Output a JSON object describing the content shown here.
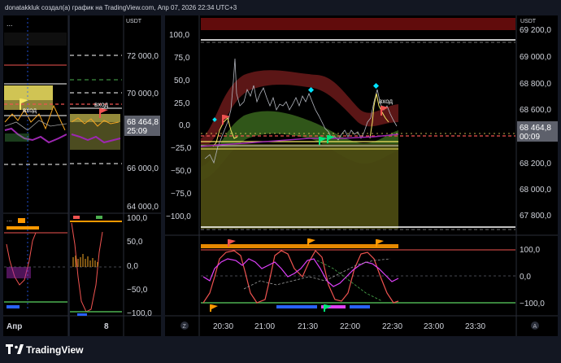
{
  "header": {
    "caption": "donatakkluk создал(а) график на TradingView.com, Апр 07, 2026 22:34 UTC+3"
  },
  "panes": {
    "left1": {
      "currency": "USDT",
      "dots": "...",
      "entry_label": "вход",
      "x_label": "Апр",
      "indicator_dots": "..."
    },
    "left2": {
      "currency": "USDT",
      "entry_label": "вход",
      "price_ticks": [
        "72 000,0",
        "70 000,0",
        "66 000,0",
        "64 000,0"
      ],
      "price_badge_value": "68 464,8",
      "price_badge_time": "25:09",
      "osc_ticks": [
        "100,0",
        "50,0",
        "0,0",
        "−50,0",
        "−100,0"
      ],
      "x_label": "8"
    },
    "main": {
      "currency": "USDT",
      "entry_label": "вход",
      "left_ticks": [
        "100,0",
        "75,0",
        "50,0",
        "25,0",
        "0,0",
        "−25,0",
        "−50,0",
        "−75,0",
        "−100,0"
      ],
      "right_ticks": [
        "69 200,0",
        "69 000,0",
        "68 800,0",
        "68 600,0",
        "68 200,0",
        "68 000,0",
        "67 800,0"
      ],
      "price_badge_value": "68 464,8",
      "price_badge_time": "00:09",
      "osc_ticks": [
        "100,0",
        "0,0",
        "−100,0"
      ],
      "time_labels": [
        "20:30",
        "21:00",
        "21:30",
        "22:00",
        "22:30",
        "23:00",
        "23:30"
      ],
      "z_btn": "Z",
      "a_btn": "A"
    }
  },
  "footer": {
    "logo_text": "TradingView"
  },
  "colors": {
    "background": "#131722",
    "up": "#26a69a",
    "down": "#ef5350",
    "accent": "#2962ff",
    "badge": "#5d606b"
  }
}
